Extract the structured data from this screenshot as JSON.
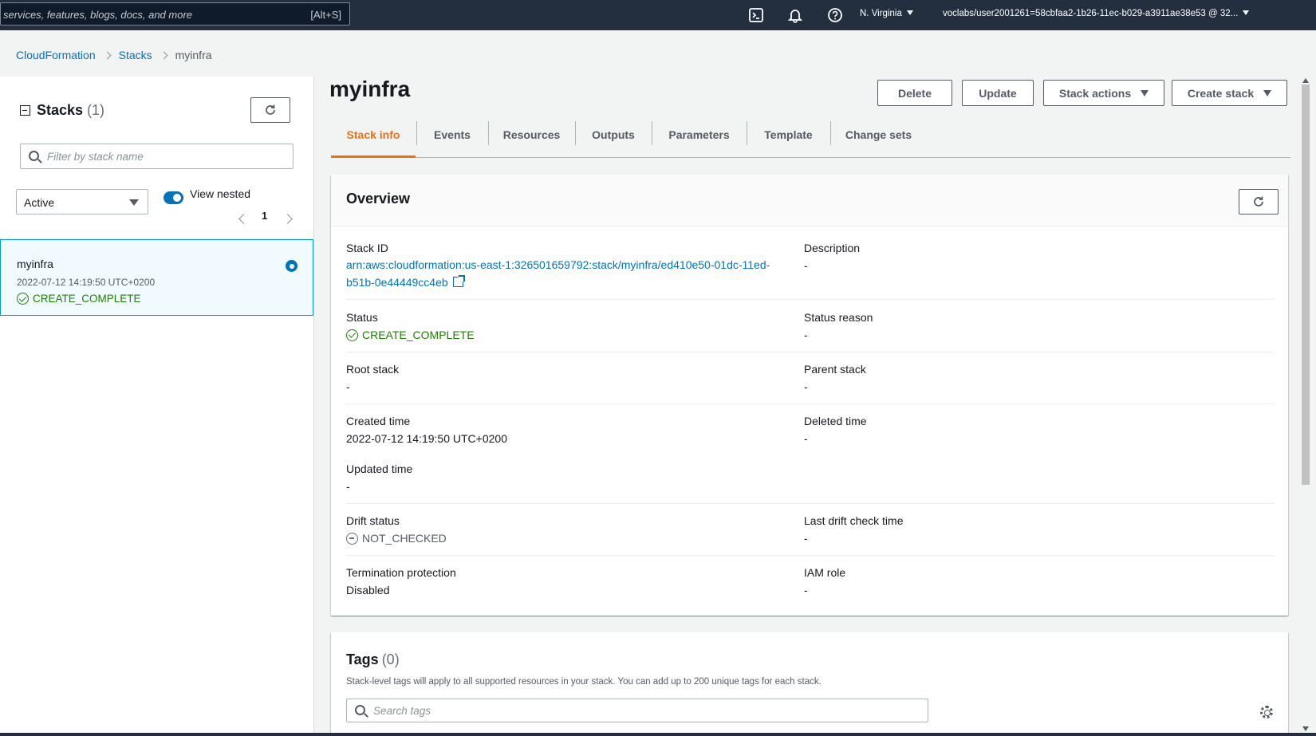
{
  "topbar": {
    "search_placeholder": "services, features, blogs, docs, and more",
    "search_shortcut": "[Alt+S]",
    "region": "N. Virginia",
    "account": "voclabs/user2001261=58cbfaa2-1b26-11ec-b029-a3911ae38e53 @ 32..."
  },
  "breadcrumb": {
    "items": [
      "CloudFormation",
      "Stacks"
    ],
    "current": "myinfra"
  },
  "stacks_panel": {
    "title": "Stacks",
    "count": "(1)",
    "filter_placeholder": "Filter by stack name",
    "status_filter": "Active",
    "view_nested_label": "View nested",
    "view_nested_on": true,
    "page": "1",
    "stack": {
      "name": "myinfra",
      "created": "2022-07-12 14:19:50 UTC+0200",
      "status": "CREATE_COMPLETE"
    }
  },
  "main": {
    "title": "myinfra",
    "buttons": {
      "delete": "Delete",
      "update": "Update",
      "stack_actions": "Stack actions",
      "create_stack": "Create stack"
    },
    "tabs": [
      "Stack info",
      "Events",
      "Resources",
      "Outputs",
      "Parameters",
      "Template",
      "Change sets"
    ],
    "active_tab": "Stack info"
  },
  "overview": {
    "title": "Overview",
    "stack_id_label": "Stack ID",
    "stack_id_line1": "arn:aws:cloudformation:us-east-1:326501659792:stack/myinfra/ed410e50-01dc-11ed-",
    "stack_id_line2": "b51b-0e44449cc4eb",
    "description_label": "Description",
    "description": "-",
    "status_label": "Status",
    "status": "CREATE_COMPLETE",
    "status_reason_label": "Status reason",
    "status_reason": "-",
    "root_stack_label": "Root stack",
    "root_stack": "-",
    "parent_stack_label": "Parent stack",
    "parent_stack": "-",
    "created_time_label": "Created time",
    "created_time": "2022-07-12 14:19:50 UTC+0200",
    "deleted_time_label": "Deleted time",
    "deleted_time": "-",
    "updated_time_label": "Updated time",
    "updated_time": "-",
    "drift_status_label": "Drift status",
    "drift_status": "NOT_CHECKED",
    "last_drift_label": "Last drift check time",
    "last_drift": "-",
    "termination_label": "Termination protection",
    "termination": "Disabled",
    "iam_role_label": "IAM role",
    "iam_role": "-"
  },
  "tags": {
    "title": "Tags",
    "count": "(0)",
    "description": "Stack-level tags will apply to all supported resources in your stack. You can add up to 200 unique tags for each stack.",
    "search_placeholder": "Search tags"
  },
  "colors": {
    "link": "#0073bb",
    "success": "#1d8102",
    "accent": "#ec7211",
    "topbar": "#232f3e"
  }
}
